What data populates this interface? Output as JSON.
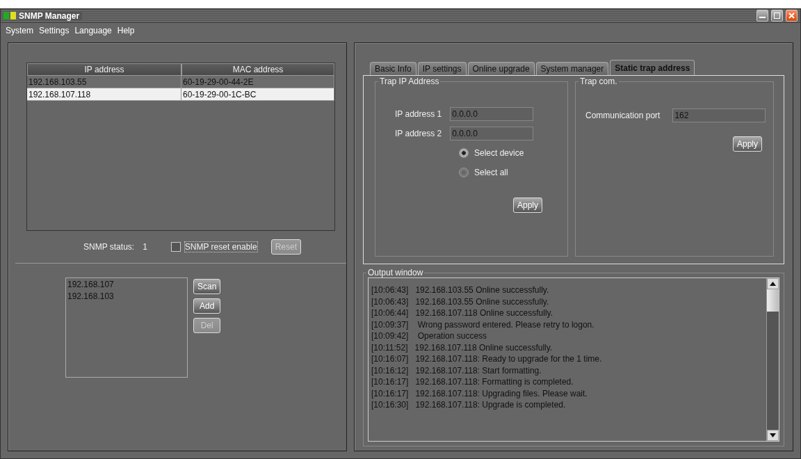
{
  "window": {
    "title": "SNMP Manager"
  },
  "menu": [
    "System",
    "Settings",
    "Language",
    "Help"
  ],
  "devices": {
    "columns": [
      "IP address",
      "MAC address"
    ],
    "rows": [
      {
        "ip": "192.168.103.55",
        "mac": "60-19-29-00-44-2E",
        "selected": false
      },
      {
        "ip": "192.168.107.118",
        "mac": "60-19-29-00-1C-BC",
        "selected": true
      }
    ]
  },
  "snmp_status": {
    "label": "SNMP status:",
    "value": "1"
  },
  "reset_enable": {
    "label": "SNMP reset enable",
    "checked": false
  },
  "reset_button": {
    "label": "Reset",
    "disabled": true
  },
  "segments": [
    "192.168.107",
    "192.168.103"
  ],
  "segment_buttons": [
    {
      "label": "Scan",
      "disabled": false
    },
    {
      "label": "Add",
      "disabled": false
    },
    {
      "label": "Del",
      "disabled": true
    }
  ],
  "tabs": [
    {
      "label": "Basic Info",
      "selected": false
    },
    {
      "label": "IP settings",
      "selected": false
    },
    {
      "label": "Online upgrade",
      "selected": false
    },
    {
      "label": "System manager",
      "selected": false
    },
    {
      "label": "Static trap address",
      "selected": true
    }
  ],
  "trap_ip": {
    "title": "Trap IP Address",
    "fields": [
      {
        "label": "IP address 1",
        "value": "0.0.0.0"
      },
      {
        "label": "IP address 2",
        "value": "0.0.0.0"
      }
    ],
    "options": [
      {
        "label": "Select device",
        "selected": true
      },
      {
        "label": "Select all",
        "selected": false
      }
    ],
    "apply": "Apply"
  },
  "trap_com": {
    "title": "Trap com.",
    "label": "Communication port",
    "value": "162",
    "apply": "Apply"
  },
  "output": {
    "title": "Output window",
    "lines": [
      {
        "time": "[10:06:43]",
        "text": "192.168.103.55 Online successfully."
      },
      {
        "time": "[10:06:43]",
        "text": "192.168.103.55 Online successfully."
      },
      {
        "time": "[10:06:44]",
        "text": "192.168.107.118 Online successfully."
      },
      {
        "time": "[10:09:37]",
        "text": " Wrong password entered. Please retry to logon."
      },
      {
        "time": "[10:09:42]",
        "text": " Operation success"
      },
      {
        "time": "[10:11:52]",
        "text": "192.168.107.118 Online successfully."
      },
      {
        "time": "[10:16:07]",
        "text": "192.168.107.118: Ready to upgrade for the 1 time."
      },
      {
        "time": "[10:16:12]",
        "text": "192.168.107.118: Start formatting."
      },
      {
        "time": "[10:16:17]",
        "text": "192.168.107.118: Formatting is completed."
      },
      {
        "time": "[10:16:17]",
        "text": "192.168.107.118: Upgrading files. Please wait."
      },
      {
        "time": "[10:16:30]",
        "text": "192.168.107.118: Upgrade is completed."
      }
    ]
  }
}
